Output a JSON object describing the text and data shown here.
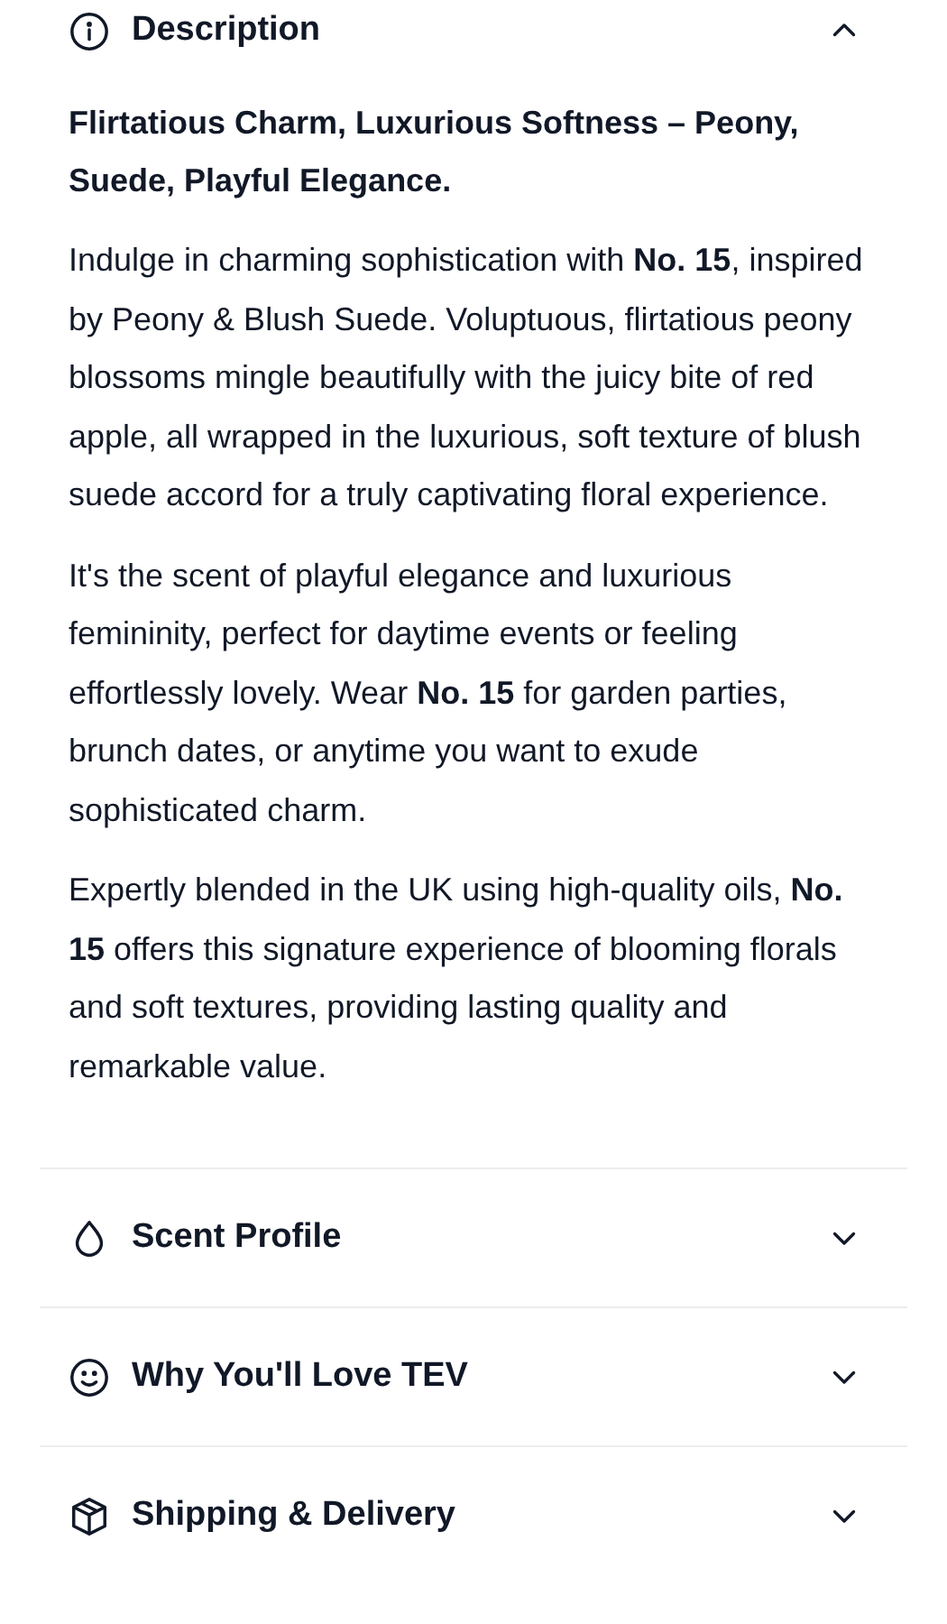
{
  "sections": [
    {
      "title": "Description",
      "expanded": true,
      "headline": "Flirtatious Charm, Luxurious Softness – Peony, Suede, Playful Elegance.",
      "paragraphs": [
        "Indulge in charming sophistication with **No. 15**, inspired by Peony & Blush Suede. Voluptuous, flirtatious peony blossoms mingle beautifully with the juicy bite of red apple, all wrapped in the luxurious, soft texture of blush suede accord for a truly captivating floral experience.",
        "It's the scent of playful elegance and luxurious femininity, perfect for daytime events or feeling effortlessly lovely. Wear **No. 15** for garden parties, brunch dates, or anytime you want to exude sophisticated charm.",
        "Expertly blended in the UK using high-quality oils, **No. 15** offers this signature experience of blooming florals and soft textures, providing lasting quality and remarkable value."
      ]
    },
    {
      "title": "Scent Profile",
      "expanded": false
    },
    {
      "title": "Why You'll Love TEV",
      "expanded": false
    },
    {
      "title": "Shipping & Delivery",
      "expanded": false
    }
  ]
}
